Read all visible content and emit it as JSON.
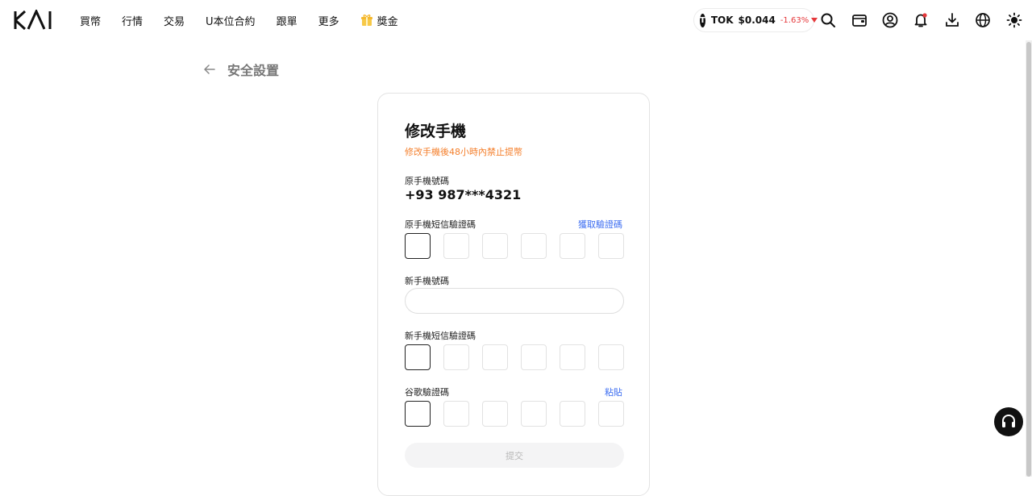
{
  "header": {
    "logo_text": "KAI",
    "nav": [
      {
        "label": "買幣"
      },
      {
        "label": "行情"
      },
      {
        "label": "交易"
      },
      {
        "label": "U本位合約"
      },
      {
        "label": "跟單"
      },
      {
        "label": "更多"
      },
      {
        "label": "獎金",
        "icon": "gift-icon"
      }
    ],
    "ticker": {
      "coin_glyph": "T",
      "symbol": "TOK",
      "price": "$0.044",
      "change": "-1.63%",
      "change_color": "#e5383b"
    },
    "icons": [
      "search-icon",
      "wallet-icon",
      "user-icon",
      "bell-icon",
      "download-icon",
      "globe-icon",
      "sun-icon"
    ]
  },
  "page": {
    "back_title": "安全設置"
  },
  "form": {
    "title": "修改手機",
    "warning": "修改手機後48小時內禁止提幣",
    "warning_color": "#f47f2c",
    "current_phone_label": "原手機號碼",
    "current_phone_value": "+93 987***4321",
    "old_sms_label": "原手機短信驗證碼",
    "get_code_link": "獲取驗證碼",
    "new_phone_label": "新手機號碼",
    "new_phone_value": "",
    "new_sms_label": "新手機短信驗證碼",
    "google_label": "谷歌驗證碼",
    "paste_link": "粘貼",
    "submit_label": "提交",
    "link_color": "#3b6cf1"
  }
}
